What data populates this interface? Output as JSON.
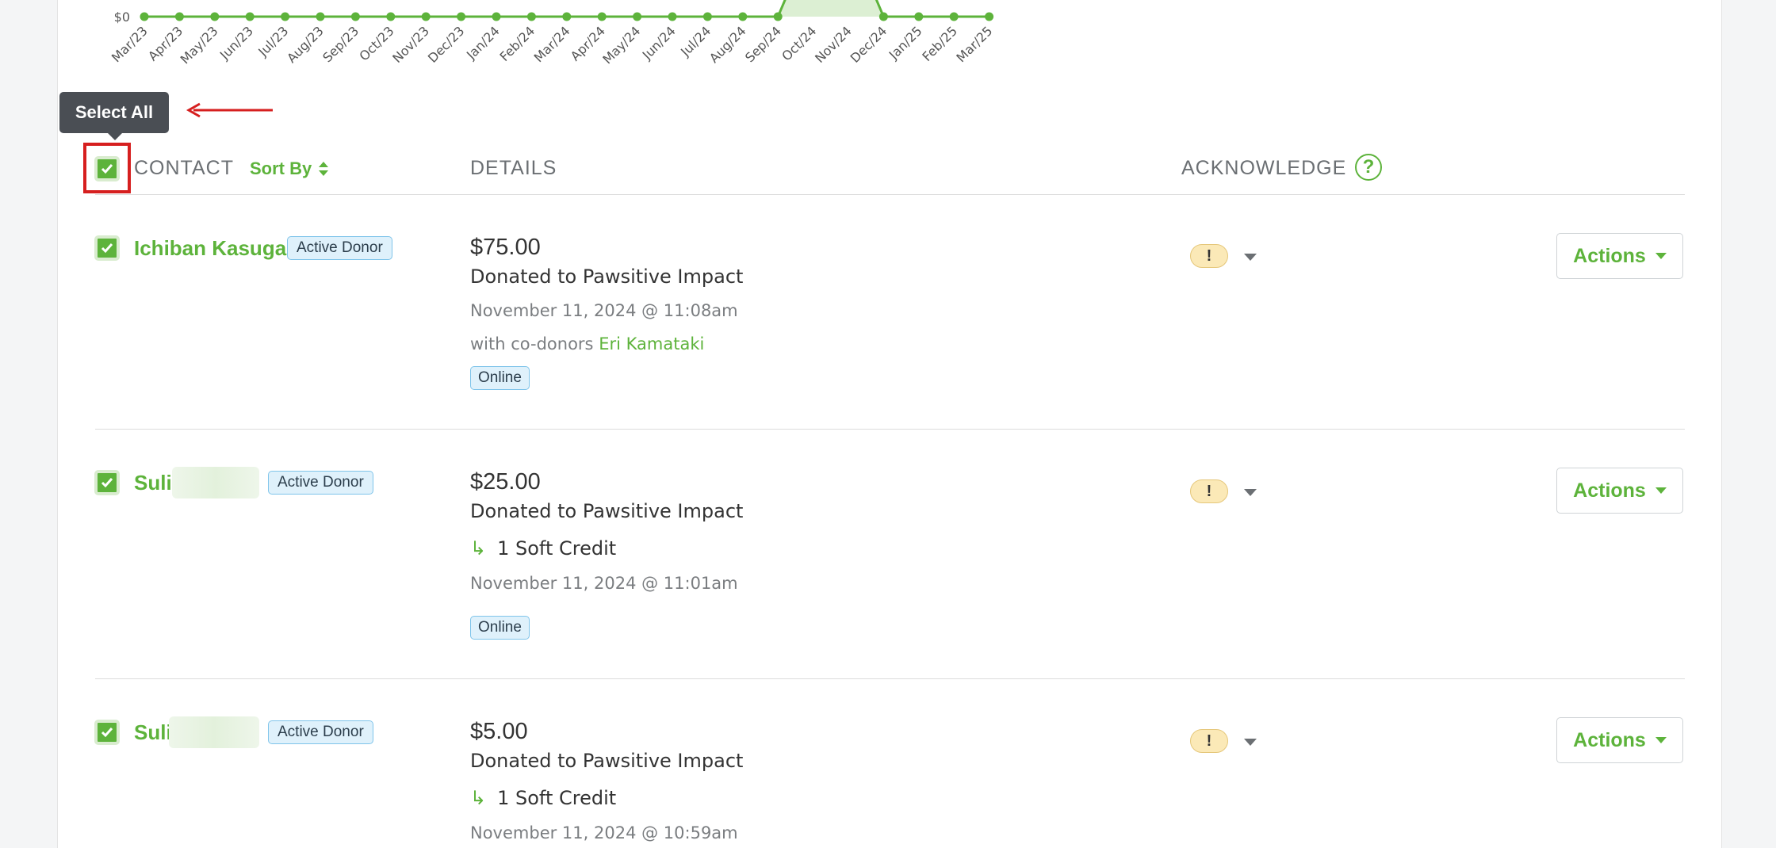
{
  "chart_data": {
    "type": "area",
    "ytick_label": "$0",
    "categories": [
      "Mar/23",
      "Apr/23",
      "May/23",
      "Jun/23",
      "Jul/23",
      "Aug/23",
      "Sep/23",
      "Oct/23",
      "Nov/23",
      "Dec/23",
      "Jan/24",
      "Feb/24",
      "Mar/24",
      "Apr/24",
      "May/24",
      "Jun/24",
      "Jul/24",
      "Aug/24",
      "Sep/24",
      "Oct/24",
      "Nov/24",
      "Dec/24",
      "Jan/25",
      "Feb/25",
      "Mar/25"
    ],
    "values": [
      0,
      0,
      0,
      0,
      0,
      0,
      0,
      0,
      0,
      0,
      0,
      0,
      0,
      0,
      0,
      0,
      0,
      0,
      0,
      105,
      105,
      0,
      0,
      0,
      0
    ],
    "color": "#5db33b",
    "fill": "#dcefd3"
  },
  "tooltip": {
    "label": "Select All"
  },
  "header": {
    "contact": "CONTACT",
    "sort_by": "Sort By",
    "details": "DETAILS",
    "acknowledge": "ACKNOWLEDGE",
    "help": "?"
  },
  "rows": [
    {
      "name": "Ichiban Kasuga",
      "badge": "Active Donor",
      "amount": "$75.00",
      "description": "Donated to Pawsitive Impact",
      "date": "November 11, 2024 @ 11:08am",
      "codonor_prefix": "with co-donors",
      "codonor_name": "Eri Kamataki",
      "channel": "Online",
      "ack_icon": "!",
      "actions": "Actions"
    },
    {
      "name": "Suli",
      "badge": "Active Donor",
      "amount": "$25.00",
      "description": "Donated to Pawsitive Impact",
      "soft_credit": "1 Soft Credit",
      "date": "November 11, 2024 @ 11:01am",
      "channel": "Online",
      "ack_icon": "!",
      "actions": "Actions"
    },
    {
      "name": "Suli",
      "badge": "Active Donor",
      "amount": "$5.00",
      "description": "Donated to Pawsitive Impact",
      "soft_credit": "1 Soft Credit",
      "date": "November 11, 2024 @ 10:59am",
      "ack_icon": "!",
      "actions": "Actions"
    }
  ]
}
